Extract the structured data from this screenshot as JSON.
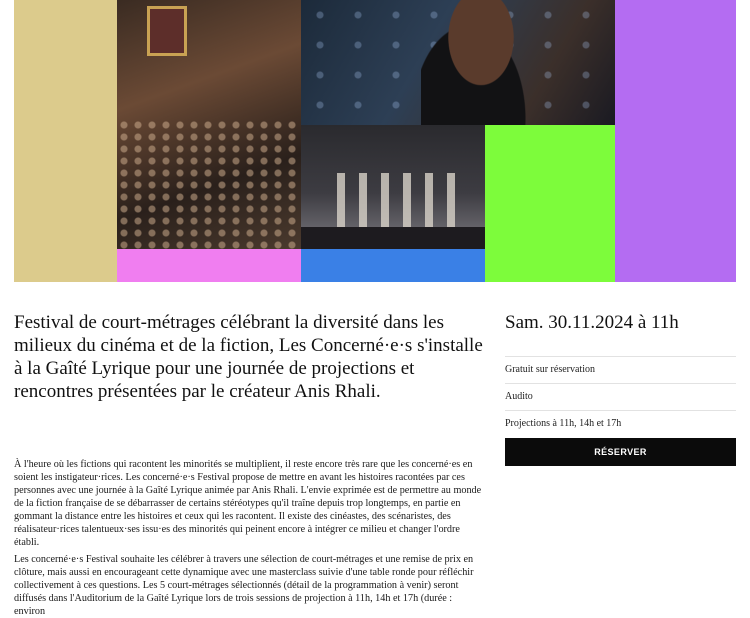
{
  "colors": {
    "gold": "#dccb8c",
    "pink": "#f07ef0",
    "blue": "#3a80e6",
    "green": "#7dfc3b",
    "violet": "#b46cf2",
    "button_bg": "#0b0b0b"
  },
  "collage": {
    "photos": [
      {
        "name": "audience-photo"
      },
      {
        "name": "portrait-photo"
      },
      {
        "name": "stage-group-photo"
      }
    ]
  },
  "event": {
    "lead": "Festival de court-métrages célébrant la diversité dans les milieux du cinéma et de la fiction, Les Concerné·e·s s'installe à la Gaîté Lyrique pour une journée de projections et rencontres présentées par le créateur Anis Rhali.",
    "paragraphs": [
      "À l'heure où les fictions qui racontent les minorités se multiplient, il reste encore très rare que les concerné·es en soient les instigateur·rices. Les concerné·e·s Festival propose de mettre en avant les histoires racontées par ces personnes avec une journée à la Gaîté Lyrique animée par Anis Rhali. L'envie exprimée est de permettre au monde de la fiction française de se débarrasser de certains stéréotypes qu'il traîne depuis trop longtemps, en partie en gommant la distance entre les histoires et ceux qui les racontent. Il existe des cinéastes, des scénaristes, des réalisateur·rices talentueux·ses issu·es des minorités qui peinent encore à intégrer ce milieu et changer l'ordre établi.",
      "Les concerné·e·s Festival souhaite les célébrer à travers une sélection de court-métrages et une remise de prix en clôture, mais aussi en encourageant cette dynamique avec une masterclass suivie d'une table ronde pour réfléchir collectivement à ces questions. Les 5 court-métrages sélectionnés (détail de la programmation à venir) seront diffusés dans l'Auditorium de la Gaîté Lyrique lors de trois sessions de projection à 11h, 14h et 17h (durée : environ"
    ]
  },
  "sidebar": {
    "date": "Sam. 30.11.2024 à 11h",
    "info": [
      "Gratuit sur réservation",
      "Audito",
      "Projections à 11h, 14h et 17h"
    ],
    "reserve_label": "RÉSERVER"
  }
}
